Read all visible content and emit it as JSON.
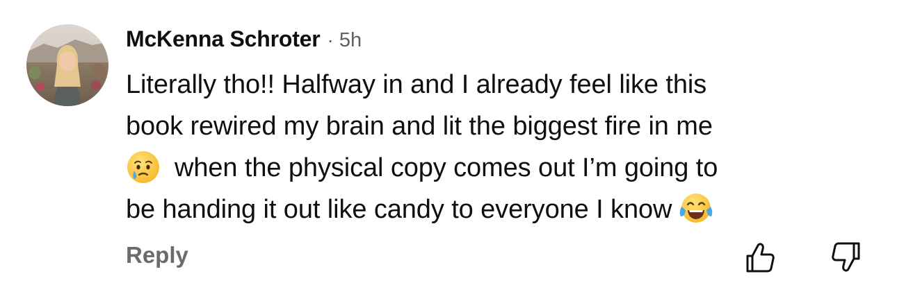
{
  "comment": {
    "author": "McKenna Schroter",
    "separator": "·",
    "time_ago": "5h",
    "body_lines": [
      "Literally tho!! Halfway in and I already feel like this",
      "book rewired my brain and lit the biggest fire in me",
      "when the physical copy comes out I’m going to",
      "be handing it out like candy to everyone I know"
    ],
    "emojis": [
      "face-holding-back-tears",
      "face-with-tears-of-joy"
    ],
    "reply_label": "Reply",
    "icons": [
      "thumbs-up-icon",
      "thumbs-down-icon"
    ]
  },
  "colors": {
    "text": "#0f0f0f",
    "secondary": "#606060",
    "reply": "#6b6b6b",
    "background": "#ffffff"
  }
}
